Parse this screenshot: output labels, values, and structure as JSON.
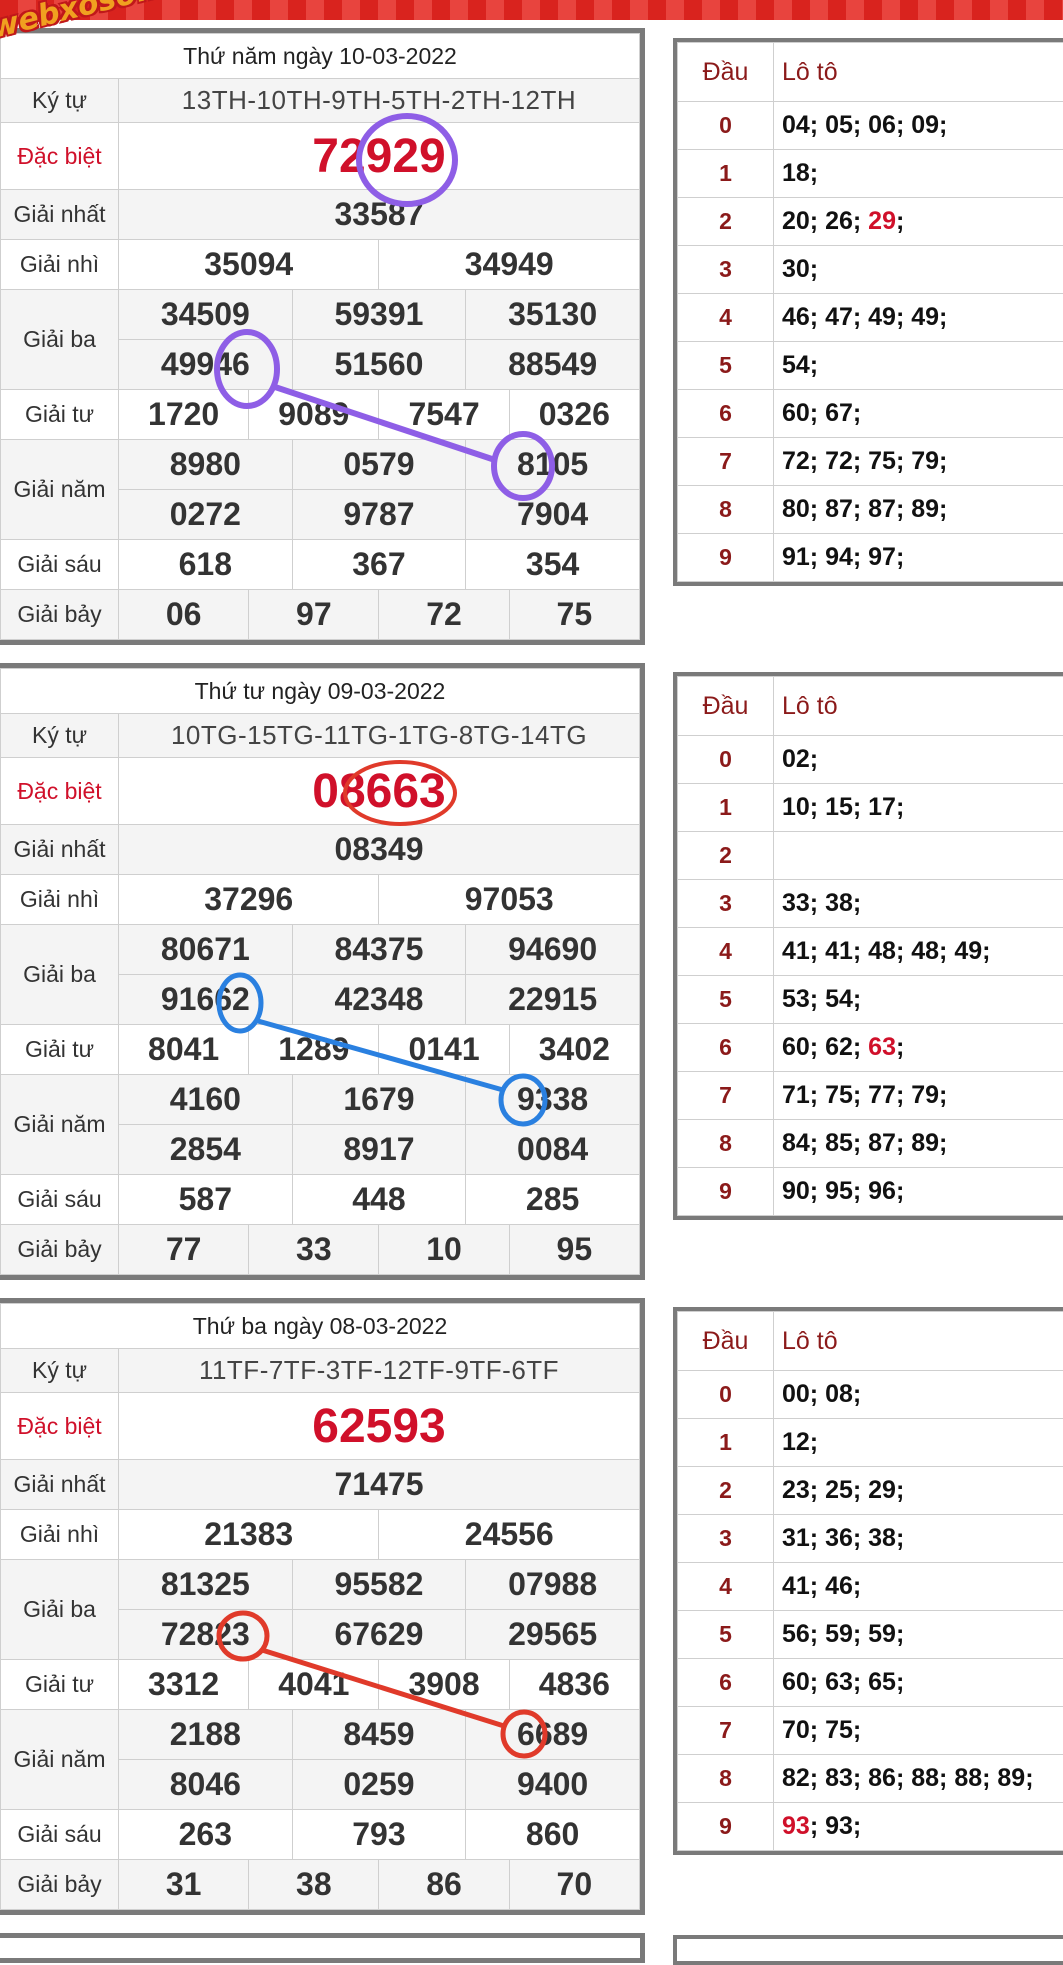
{
  "watermark": "webxoso.net",
  "colors": {
    "accent_red": "#d0102a",
    "circle_purple": "#8e5ee6",
    "circle_blue": "#2a80e0",
    "circle_red": "#e03a2a"
  },
  "labels": {
    "kytu": "Ký tự",
    "db": "Đặc biệt",
    "g1": "Giải nhất",
    "g2": "Giải nhì",
    "g3": "Giải ba",
    "g4": "Giải tư",
    "g5": "Giải năm",
    "g6": "Giải sáu",
    "g7": "Giải bảy",
    "dau": "Đầu",
    "loto": "Lô tô"
  },
  "draws": [
    {
      "title": "Thứ năm ngày 10-03-2022",
      "kytu": "13TH-10TH-9TH-5TH-2TH-12TH",
      "db": "72929",
      "g1": "33587",
      "g2": [
        "35094",
        "34949"
      ],
      "g3": [
        "34509",
        "59391",
        "35130",
        "49946",
        "51560",
        "88549"
      ],
      "g4": [
        "1720",
        "9089",
        "7547",
        "0326"
      ],
      "g5": [
        "8980",
        "0579",
        "8105",
        "0272",
        "9787",
        "7904"
      ],
      "g6": [
        "618",
        "367",
        "354"
      ],
      "g7": [
        "06",
        "97",
        "72",
        "75"
      ],
      "loto": [
        {
          "dau": "0",
          "pre": "04; 05; 06; 09;",
          "hl": "",
          "post": ""
        },
        {
          "dau": "1",
          "pre": "18;",
          "hl": "",
          "post": ""
        },
        {
          "dau": "2",
          "pre": "20; 26; ",
          "hl": "29",
          "post": ";"
        },
        {
          "dau": "3",
          "pre": "30;",
          "hl": "",
          "post": ""
        },
        {
          "dau": "4",
          "pre": "46; 47; 49; 49;",
          "hl": "",
          "post": ""
        },
        {
          "dau": "5",
          "pre": "54;",
          "hl": "",
          "post": ""
        },
        {
          "dau": "6",
          "pre": "60; 67;",
          "hl": "",
          "post": ""
        },
        {
          "dau": "7",
          "pre": "72; 72; 75; 79;",
          "hl": "",
          "post": ""
        },
        {
          "dau": "8",
          "pre": "80; 87; 87; 89;",
          "hl": "",
          "post": ""
        },
        {
          "dau": "9",
          "pre": "91; 94; 97;",
          "hl": "",
          "post": ""
        }
      ]
    },
    {
      "title": "Thứ tư ngày 09-03-2022",
      "kytu": "10TG-15TG-11TG-1TG-8TG-14TG",
      "db": "08663",
      "g1": "08349",
      "g2": [
        "37296",
        "97053"
      ],
      "g3": [
        "80671",
        "84375",
        "94690",
        "91662",
        "42348",
        "22915"
      ],
      "g4": [
        "8041",
        "1289",
        "0141",
        "3402"
      ],
      "g5": [
        "4160",
        "1679",
        "9338",
        "2854",
        "8917",
        "0084"
      ],
      "g6": [
        "587",
        "448",
        "285"
      ],
      "g7": [
        "77",
        "33",
        "10",
        "95"
      ],
      "loto": [
        {
          "dau": "0",
          "pre": "02;",
          "hl": "",
          "post": ""
        },
        {
          "dau": "1",
          "pre": "10; 15; 17;",
          "hl": "",
          "post": ""
        },
        {
          "dau": "2",
          "pre": "",
          "hl": "",
          "post": ""
        },
        {
          "dau": "3",
          "pre": "33; 38;",
          "hl": "",
          "post": ""
        },
        {
          "dau": "4",
          "pre": "41; 41; 48; 48; 49;",
          "hl": "",
          "post": ""
        },
        {
          "dau": "5",
          "pre": "53; 54;",
          "hl": "",
          "post": ""
        },
        {
          "dau": "6",
          "pre": "60; 62; ",
          "hl": "63",
          "post": ";"
        },
        {
          "dau": "7",
          "pre": "71; 75; 77; 79;",
          "hl": "",
          "post": ""
        },
        {
          "dau": "8",
          "pre": "84; 85; 87; 89;",
          "hl": "",
          "post": ""
        },
        {
          "dau": "9",
          "pre": "90; 95; 96;",
          "hl": "",
          "post": ""
        }
      ]
    },
    {
      "title": "Thứ ba ngày 08-03-2022",
      "kytu": "11TF-7TF-3TF-12TF-9TF-6TF",
      "db": "62593",
      "g1": "71475",
      "g2": [
        "21383",
        "24556"
      ],
      "g3": [
        "81325",
        "95582",
        "07988",
        "72823",
        "67629",
        "29565"
      ],
      "g4": [
        "3312",
        "4041",
        "3908",
        "4836"
      ],
      "g5": [
        "2188",
        "8459",
        "6689",
        "8046",
        "0259",
        "9400"
      ],
      "g6": [
        "263",
        "793",
        "860"
      ],
      "g7": [
        "31",
        "38",
        "86",
        "70"
      ],
      "loto": [
        {
          "dau": "0",
          "pre": "00; 08;",
          "hl": "",
          "post": ""
        },
        {
          "dau": "1",
          "pre": "12;",
          "hl": "",
          "post": ""
        },
        {
          "dau": "2",
          "pre": "23; 25; 29;",
          "hl": "",
          "post": ""
        },
        {
          "dau": "3",
          "pre": "31; 36; 38;",
          "hl": "",
          "post": ""
        },
        {
          "dau": "4",
          "pre": "41; 46;",
          "hl": "",
          "post": ""
        },
        {
          "dau": "5",
          "pre": "56; 59; 59;",
          "hl": "",
          "post": ""
        },
        {
          "dau": "6",
          "pre": "60; 63; 65;",
          "hl": "",
          "post": ""
        },
        {
          "dau": "7",
          "pre": "70; 75;",
          "hl": "",
          "post": ""
        },
        {
          "dau": "8",
          "pre": "82; 83; 86; 88; 88; 89;",
          "hl": "",
          "post": ""
        },
        {
          "dau": "9",
          "pre": "",
          "hl": "93",
          "post": "; 93;"
        }
      ]
    }
  ]
}
